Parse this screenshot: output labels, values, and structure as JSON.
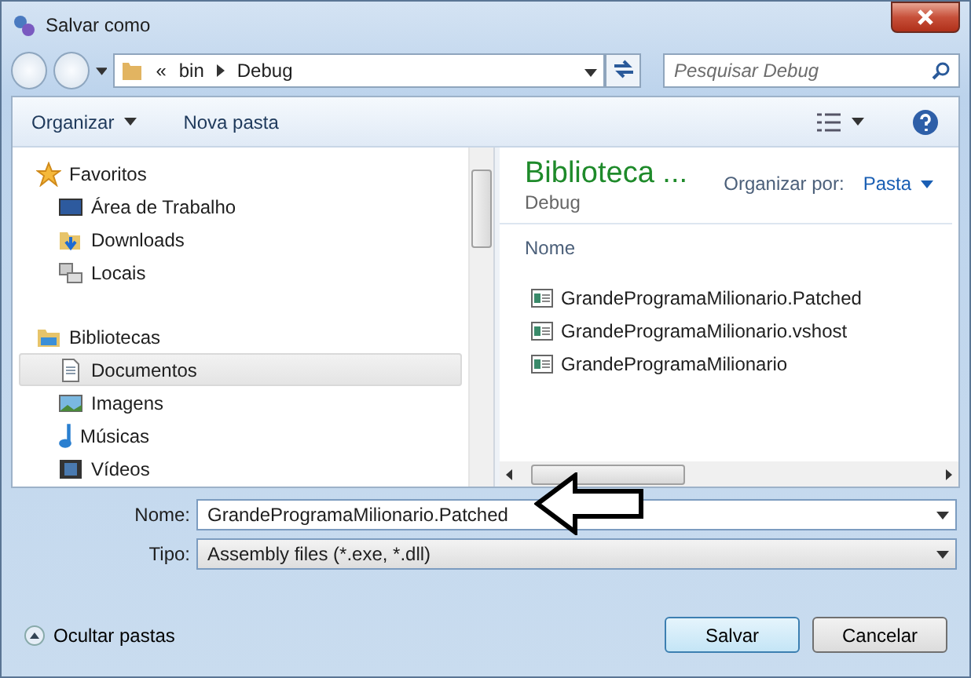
{
  "window": {
    "title": "Salvar como"
  },
  "address": {
    "overflow": "«",
    "crumbs": [
      "bin",
      "Debug"
    ]
  },
  "search": {
    "placeholder": "Pesquisar Debug"
  },
  "toolbar": {
    "organize": "Organizar",
    "new_folder": "Nova pasta"
  },
  "nav": [
    {
      "label": "Favoritos",
      "kind": "favorites",
      "children": [
        {
          "label": "Área de Trabalho",
          "kind": "desktop",
          "selected": false
        },
        {
          "label": "Downloads",
          "kind": "downloads",
          "selected": false
        },
        {
          "label": "Locais",
          "kind": "places",
          "selected": false
        }
      ]
    },
    {
      "label": "Bibliotecas",
      "kind": "libraries",
      "children": [
        {
          "label": "Documentos",
          "kind": "documents",
          "selected": true
        },
        {
          "label": "Imagens",
          "kind": "images",
          "selected": false
        },
        {
          "label": "Músicas",
          "kind": "music",
          "selected": false
        },
        {
          "label": "Vídeos",
          "kind": "videos",
          "selected": false
        }
      ]
    }
  ],
  "content": {
    "title": "Biblioteca ...",
    "subtitle": "Debug",
    "arrange_label": "Organizar por:",
    "arrange_value": "Pasta",
    "column": "Nome",
    "files": [
      "GrandeProgramaMilionario.Patched",
      "GrandeProgramaMilionario.vshost",
      "GrandeProgramaMilionario"
    ]
  },
  "form": {
    "name_label": "Nome:",
    "name_value": "GrandeProgramaMilionario.Patched",
    "type_label": "Tipo:",
    "type_value": "Assembly files (*.exe, *.dll)"
  },
  "footer": {
    "hide_folders": "Ocultar pastas",
    "save": "Salvar",
    "cancel": "Cancelar"
  }
}
